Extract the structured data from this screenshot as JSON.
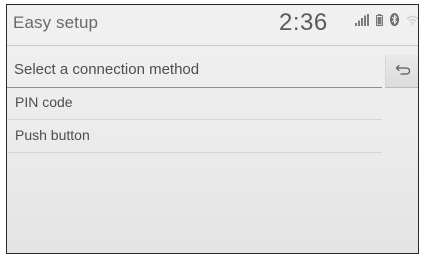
{
  "header": {
    "title": "Easy setup",
    "clock": "2:36",
    "status_icons": [
      "signal-bars-icon",
      "battery-icon",
      "bluetooth-icon",
      "wifi-icon"
    ]
  },
  "section": {
    "title": "Select a connection method",
    "back_icon": "back-arrow-icon"
  },
  "options": [
    {
      "label": "PIN code"
    },
    {
      "label": "Push button"
    }
  ],
  "colors": {
    "screen_background": "#ececec",
    "text": "#4e4e4e",
    "divider": "#d6d6d6"
  }
}
